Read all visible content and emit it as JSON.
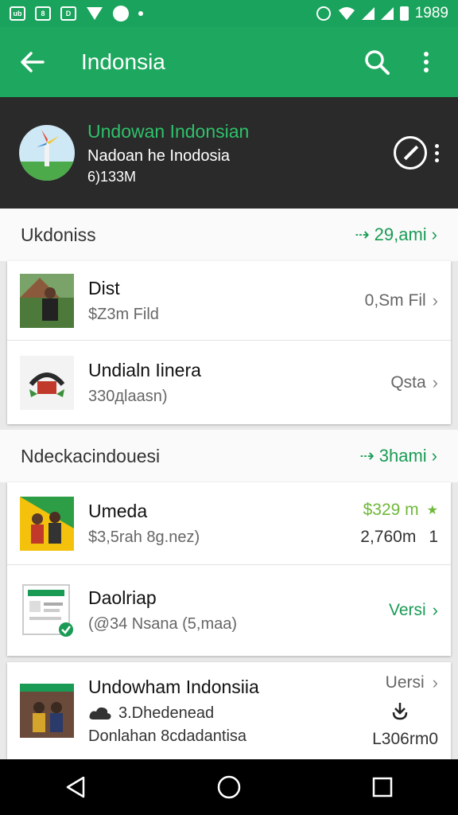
{
  "status": {
    "time": "1989"
  },
  "appbar": {
    "title": "Indonsia"
  },
  "header": {
    "title": "Undowan Indonsian",
    "subtitle": "Nadoan he Inodosia",
    "count": "6)133M"
  },
  "section1": {
    "title": "Ukdoniss",
    "link": "29,ami",
    "items": [
      {
        "title": "Dist",
        "sub": "$Z3m Fild",
        "right": "0,Sm Fil"
      },
      {
        "title": "Undialn Iinera",
        "sub": "330дlaasn)",
        "right": "Qsta"
      }
    ]
  },
  "section2": {
    "title": "Ndeckacindouesi",
    "link": "3hami",
    "items": [
      {
        "title": "Umeda",
        "sub": "$3,5rah 8g.nez)",
        "price": "$329 m",
        "right": "2,760m",
        "rank": "1"
      },
      {
        "title": "Daolriap",
        "sub": "(@34 Nsana (5,maa)",
        "right": "Versi"
      }
    ]
  },
  "section3": {
    "items": [
      {
        "title": "Undowham Indonsiia",
        "sub": "3.Dhedenead",
        "sub2": "Donlahan 8cdadantisa",
        "right": "Uersi",
        "right2": "L306rm0"
      }
    ]
  },
  "colors": {
    "primary": "#1ea85f",
    "dark_header": "#2a2a2a",
    "accent_green": "#1a9b55"
  },
  "icons": [
    "back-arrow-icon",
    "search-icon",
    "more-vert-icon",
    "compass-icon",
    "chevron-right-icon",
    "star-icon",
    "download-icon",
    "cloud-icon",
    "nav-back-icon",
    "nav-home-icon",
    "nav-recents-icon"
  ]
}
